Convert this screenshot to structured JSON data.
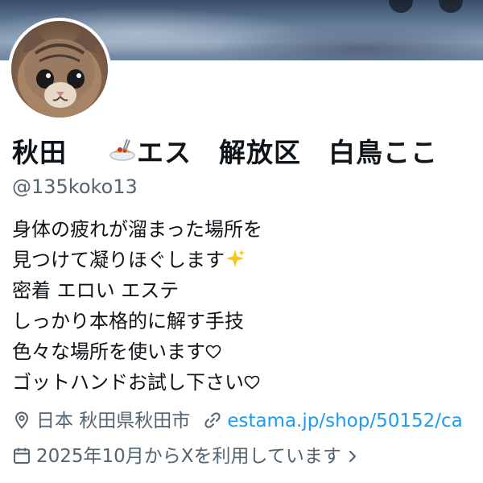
{
  "profile": {
    "display_name_part1": "秋田",
    "display_name_part2": "エス　解放区　白鳥ここ",
    "handle": "@135koko13",
    "bio_lines": [
      "身体の疲れが溜まった場所を",
      "見つけて凝りほぐします",
      "密着 エロい エステ",
      "しっかり本格的に解す手技",
      "色々な場所を使います",
      "ゴットハンドお試し下さい"
    ],
    "location": "日本 秋田県秋田市",
    "website": "estama.jp/shop/50152/ca",
    "joined": "2025年10月からXを利用しています"
  },
  "icons": {
    "name_emoji": "spaghetti-icon",
    "bio_sparkle": "sparkles-icon",
    "bio_heart": "heart-outline-icon",
    "location": "location-pin-icon",
    "website": "link-icon",
    "joined": "calendar-icon",
    "joined_more": "chevron-right-icon"
  },
  "colors": {
    "text": "#0f1419",
    "secondary": "#536471",
    "link": "#1d9bf0"
  }
}
